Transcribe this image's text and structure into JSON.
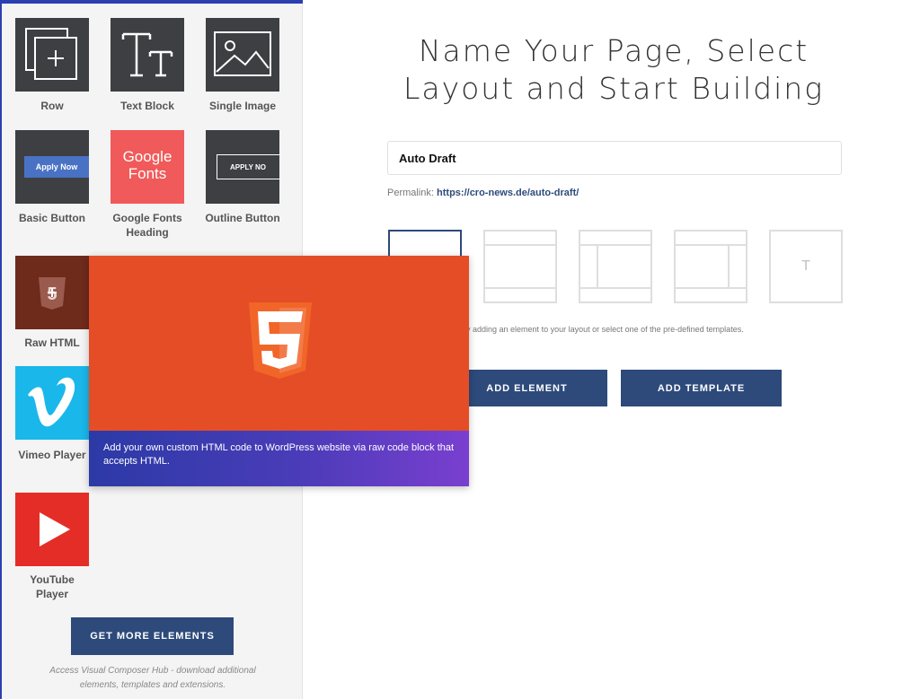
{
  "sidebar": {
    "elements": [
      {
        "label": "Row"
      },
      {
        "label": "Text Block"
      },
      {
        "label": "Single Image"
      },
      {
        "label": "Basic Button",
        "preview_text": "Apply Now"
      },
      {
        "label": "Google Fonts Heading",
        "preview_text_1": "Google",
        "preview_text_2": "Fonts"
      },
      {
        "label": "Outline Button",
        "preview_text": "APPLY NO"
      },
      {
        "label": "Raw HTML"
      },
      {
        "label": "Vimeo Player"
      },
      {
        "label": "YouTube Player"
      }
    ],
    "get_more_label": "GET MORE ELEMENTS",
    "hub_note": "Access Visual Composer Hub - download additional elements, templates and extensions."
  },
  "main": {
    "title": "Name Your Page, Select Layout and Start Building",
    "page_name_value": "Auto Draft",
    "permalink_label": "Permalink:",
    "permalink_url": "https://cro-news.de/auto-draft/",
    "layout_text_glyph": "T",
    "hint": "by adding an element to your layout or select one of the pre-defined templates.",
    "add_element_label": "ADD ELEMENT",
    "add_template_label": "ADD TEMPLATE"
  },
  "tooltip": {
    "description": "Add your own custom HTML code to WordPress website via raw code block that accepts HTML."
  },
  "colors": {
    "accent": "#2d4a7b",
    "html5_orange": "#e44d26",
    "vimeo_blue": "#1ab7ea",
    "youtube_red": "#e52d27",
    "google_fonts_coral": "#f05a5a"
  }
}
